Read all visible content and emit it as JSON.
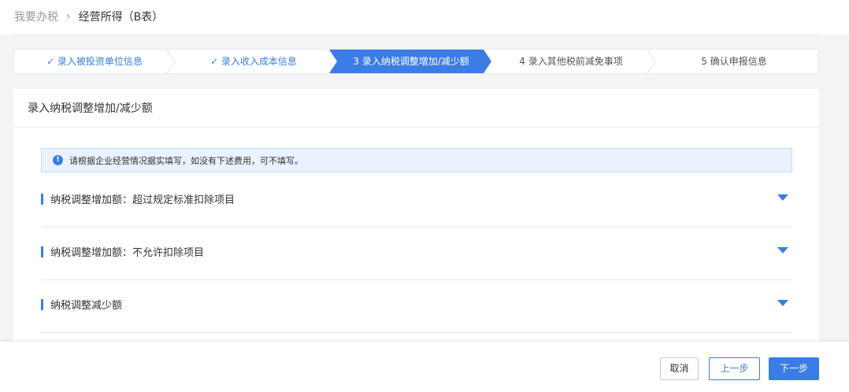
{
  "breadcrumb": {
    "home": "我要办税",
    "separator": "›",
    "current": "经营所得（B表）"
  },
  "steps": [
    {
      "label": "✓ 录入被投资单位信息",
      "status": "done"
    },
    {
      "label": "✓ 录入收入成本信息",
      "status": "done"
    },
    {
      "label": "3 录入纳税调整增加/减少额",
      "status": "active"
    },
    {
      "label": "4 录入其他税前减免事项",
      "status": "todo"
    },
    {
      "label": "5 确认申报信息",
      "status": "todo"
    }
  ],
  "card": {
    "title": "录入纳税调整增加/减少额",
    "notice": {
      "icon": "info-icon",
      "icon_glyph": "!",
      "text": "请根据企业经营情况据实填写，如没有下述费用，可不填写。"
    },
    "sections": [
      {
        "label": "纳税调整增加额：超过规定标准扣除项目"
      },
      {
        "label": "纳税调整增加额：不允许扣除项目"
      },
      {
        "label": "纳税调整减少额"
      }
    ]
  },
  "footer": {
    "cancel": "取消",
    "prev": "上一步",
    "next": "下一步"
  },
  "colors": {
    "accent": "#3b7ce6",
    "notice_bg": "#e9f2fd",
    "page_bg": "#f3f4f6"
  }
}
